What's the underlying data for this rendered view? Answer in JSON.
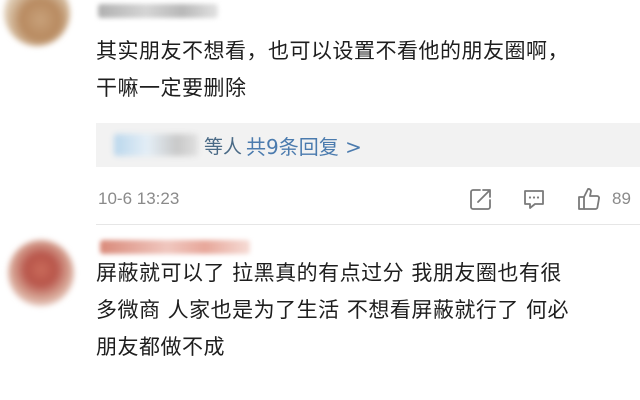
{
  "comments": [
    {
      "username": "",
      "text_line1": "其实朋友不想看，也可以设置不看他的朋友圈啊，",
      "text_line2": "干嘛一定要删除",
      "reply_people": "等人",
      "reply_count": "共9条回复 >",
      "timestamp": "10-6 13:23",
      "like_count": "89"
    },
    {
      "username": "",
      "text_line1": "屏蔽就可以了 拉黑真的有点过分 我朋友圈也有很",
      "text_line2": "多微商 人家也是为了生活 不想看屏蔽就行了 何必",
      "text_line3": "朋友都做不成"
    }
  ],
  "icons": {
    "share": "share-icon",
    "reply": "comment-icon",
    "like": "thumbs-up-icon"
  }
}
